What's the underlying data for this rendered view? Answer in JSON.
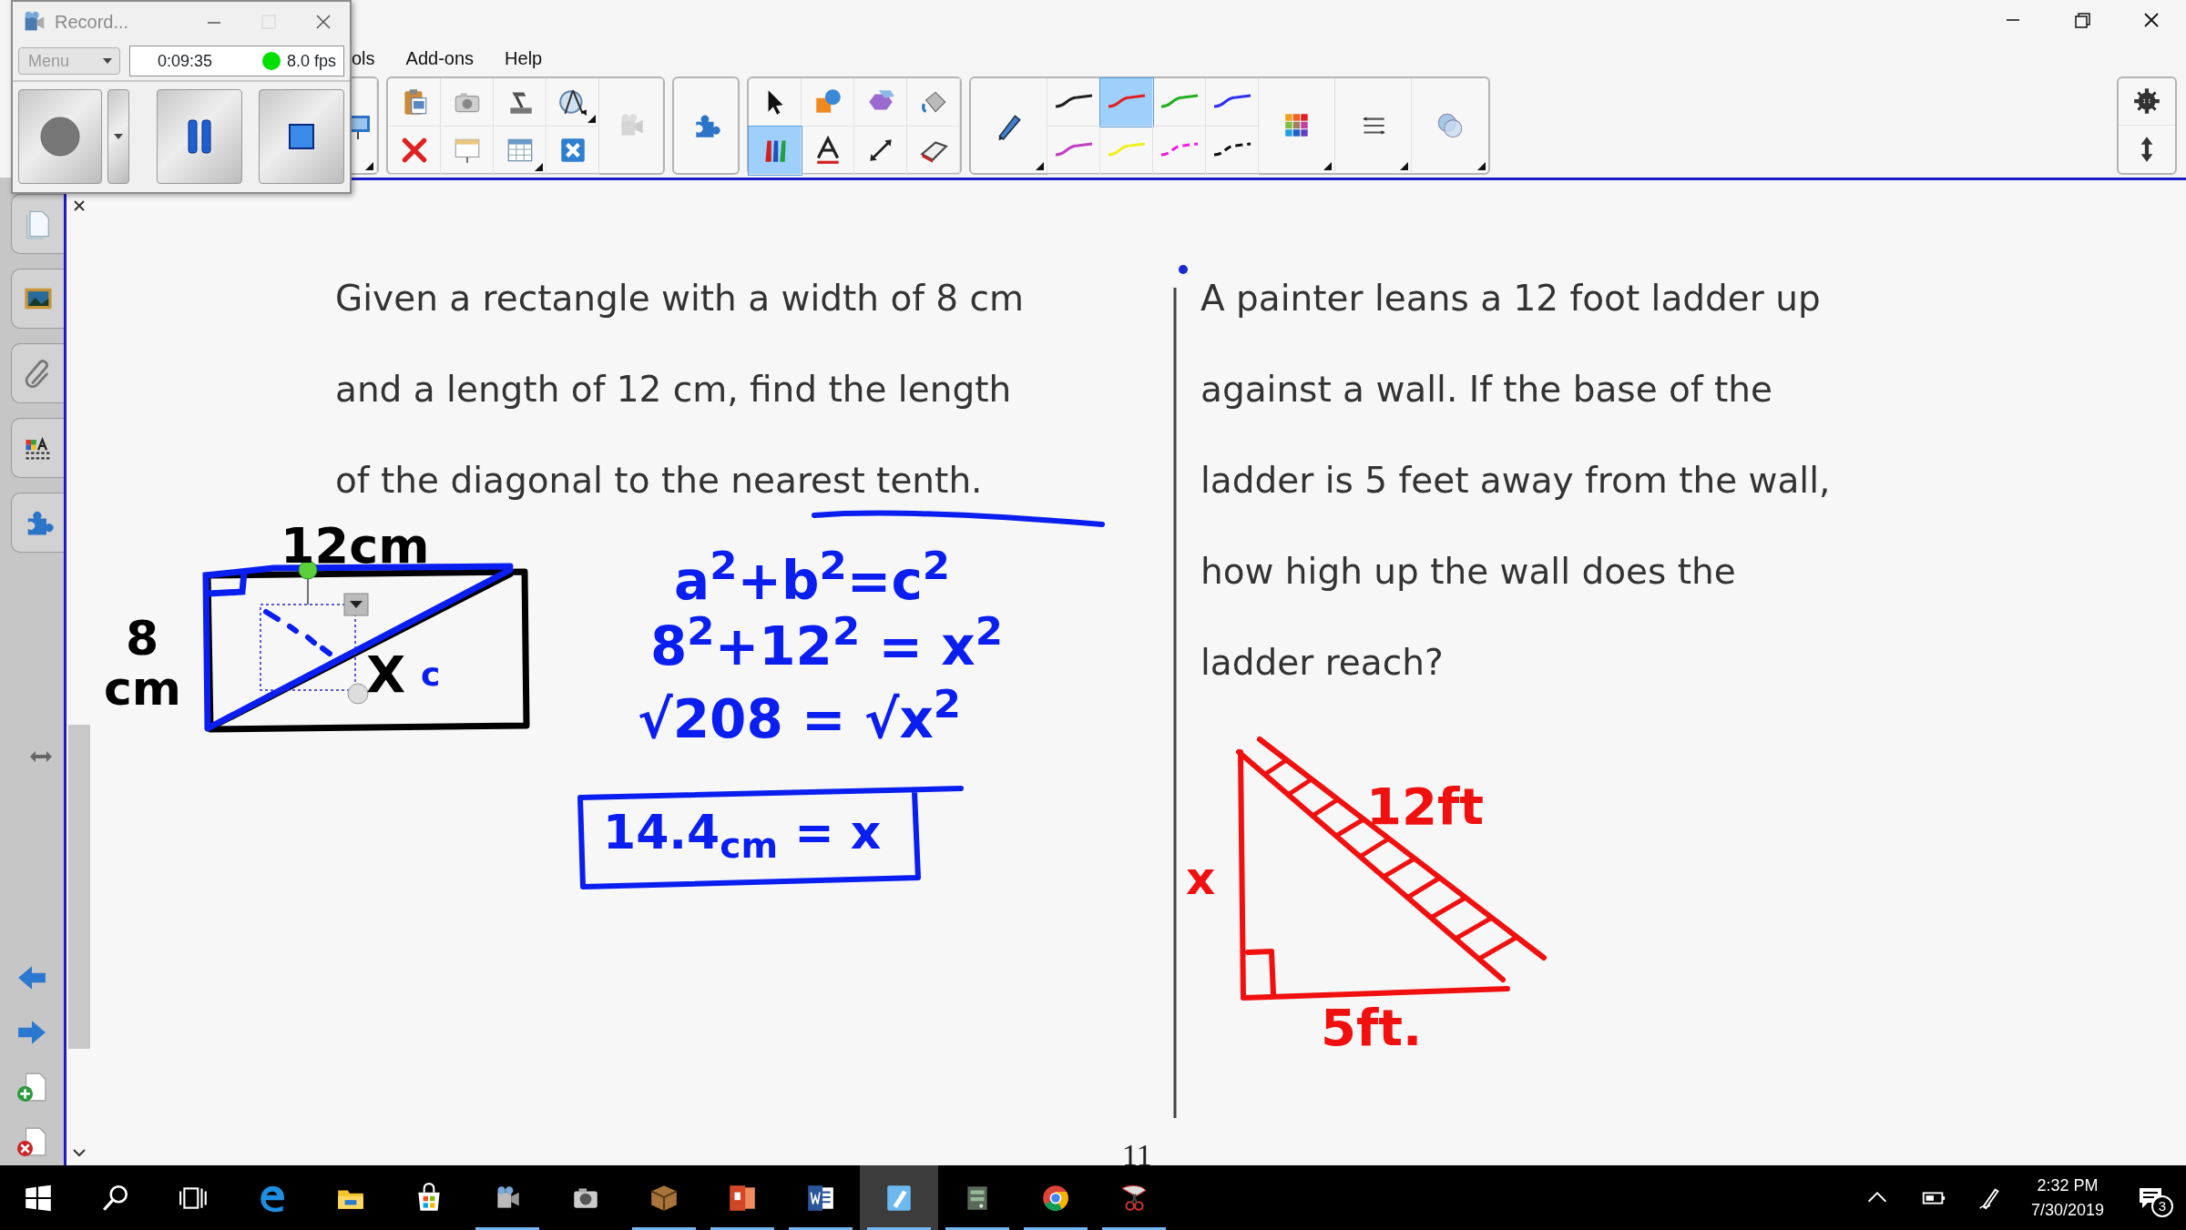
{
  "recorder": {
    "title": "Record...",
    "maximize_disabled": true,
    "menu": {
      "label": "Menu",
      "disabled": true
    },
    "elapsed": "0:09:35",
    "fps": "8.0 fps"
  },
  "menu_bar": [
    "ols",
    "Add-ons",
    "Help"
  ],
  "toolbar": {
    "tools": [
      {
        "selected": false
      },
      {
        "selected": false
      },
      {
        "selected": false
      },
      {
        "selected": false
      },
      {
        "selected": true
      },
      {
        "selected": false
      },
      {
        "selected": false
      },
      {
        "selected": false
      }
    ],
    "pen_styles": [
      {
        "color": "#202020",
        "dashed": false,
        "selected": false
      },
      {
        "color": "#e02020",
        "dashed": false,
        "selected": true
      },
      {
        "color": "#20b020",
        "dashed": false,
        "selected": false
      },
      {
        "color": "#3030f0",
        "dashed": false,
        "selected": false
      },
      {
        "color": "#c040c0",
        "dashed": false,
        "selected": false
      },
      {
        "color": "#f0f020",
        "dashed": false,
        "selected": false
      },
      {
        "color": "#f020e0",
        "dashed": true,
        "selected": false
      },
      {
        "color": "#101010",
        "dashed": true,
        "selected": false
      }
    ]
  },
  "page": {
    "questions": [
      {
        "lines": [
          "Given a rectangle with a width of 8 cm",
          "and a length of 12 cm, find the length",
          "of the diagonal to the nearest tenth."
        ]
      },
      {
        "lines": [
          "A painter leans a 12 foot ladder up",
          "against a wall.  If the base of the",
          "ladder is 5 feet away from the wall,",
          "how high up the wall does the",
          "ladder reach?"
        ]
      }
    ],
    "ink_labels": [
      {
        "text": "12cm",
        "color": "#000000"
      },
      {
        "text": "8 cm",
        "color": "#000000"
      },
      {
        "text": "X",
        "color": "#000000"
      },
      {
        "text": "c",
        "color": "#0a1ef0"
      },
      {
        "text": "a$^{2}$+b$^{2}$=c$^{2}$",
        "color": "#0a1ef0"
      },
      {
        "text": "8$^{2}$+12$^{2}$ = x$^{2}$",
        "color": "#0a1ef0"
      },
      {
        "text": "√208 = √x$^{2}$",
        "color": "#0a1ef0"
      },
      {
        "text": "14.4$_{cm}$ = x",
        "color": "#0a1ef0"
      },
      {
        "text": "12ft",
        "color": "#f01010"
      },
      {
        "text": "x",
        "color": "#f01010"
      },
      {
        "text": "5ft.",
        "color": "#f01010"
      }
    ],
    "page_number": "11"
  },
  "taskbar": {
    "apps": [
      {
        "running": false,
        "selected": false
      },
      {
        "running": false,
        "selected": false
      },
      {
        "running": false,
        "selected": false
      },
      {
        "running": true,
        "selected": false
      },
      {
        "running": false,
        "selected": false
      },
      {
        "running": true,
        "selected": false
      },
      {
        "running": true,
        "selected": false
      },
      {
        "running": true,
        "selected": false
      },
      {
        "running": true,
        "selected": true
      },
      {
        "running": true,
        "selected": false
      },
      {
        "running": true,
        "selected": false
      },
      {
        "running": true,
        "selected": false
      }
    ],
    "time": "2:32 PM",
    "date": "7/30/2019",
    "notifications": "3"
  }
}
